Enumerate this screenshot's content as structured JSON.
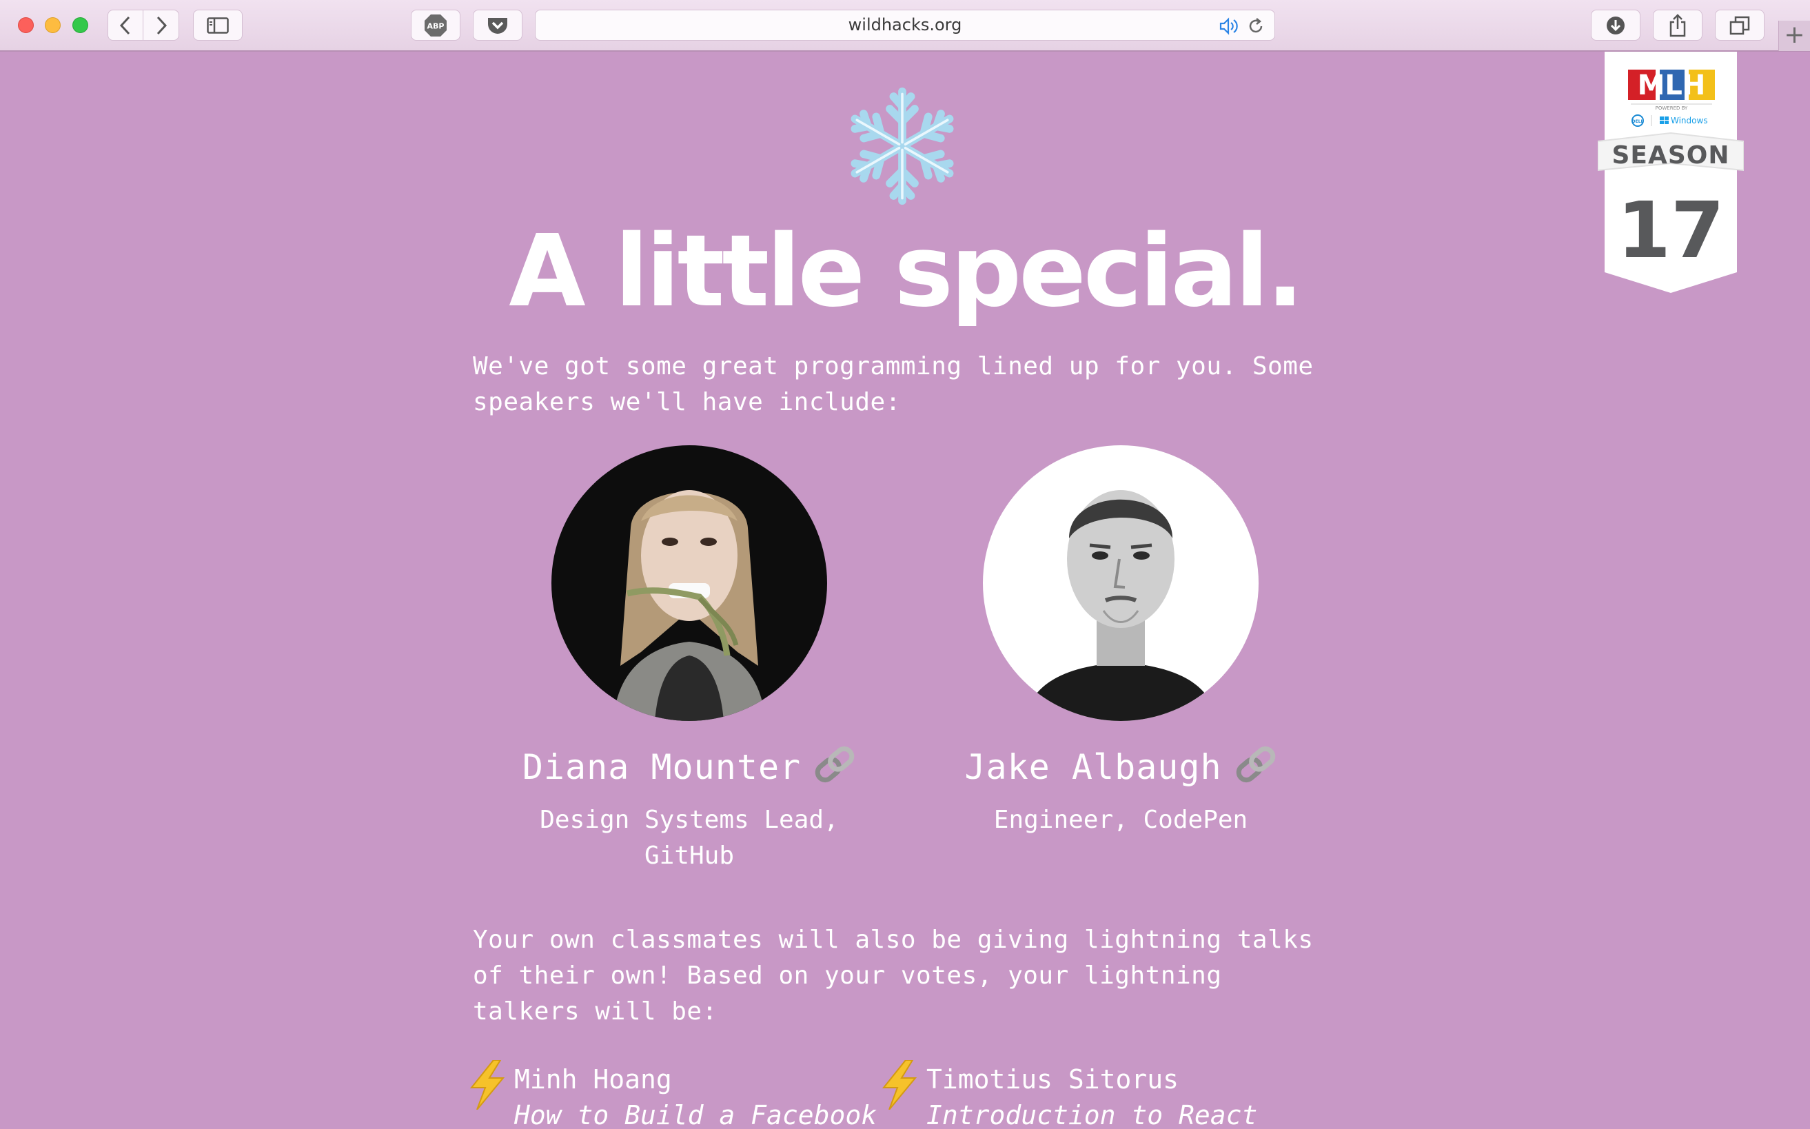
{
  "browser": {
    "url": "wildhacks.org"
  },
  "page": {
    "headline": "A little special.",
    "intro": "We've got some great programming lined up for you. Some speakers we'll have include:",
    "speakers": [
      {
        "name": "Diana Mounter",
        "role": "Design Systems Lead, GitHub"
      },
      {
        "name": "Jake Albaugh",
        "role": "Engineer, CodePen"
      }
    ],
    "lightning_intro": "Your own classmates will also be giving lightning talks of their own! Based on your votes, your lightning talkers will be:",
    "lightning_talks": [
      {
        "name": "Minh Hoang",
        "title": "How to Build a Facebook"
      },
      {
        "name": "Timotius Sitorus",
        "title": "Introduction to React"
      }
    ]
  },
  "mlh_badge": {
    "logo": "MLH",
    "powered_by": "POWERED BY",
    "sponsor_1": "DELL",
    "sponsor_2": "Windows",
    "season_label": "SEASON",
    "season_number": "17"
  },
  "colors": {
    "page_background": "#c898c6",
    "text": "#ffffff",
    "badge_gray": "#58595b"
  }
}
